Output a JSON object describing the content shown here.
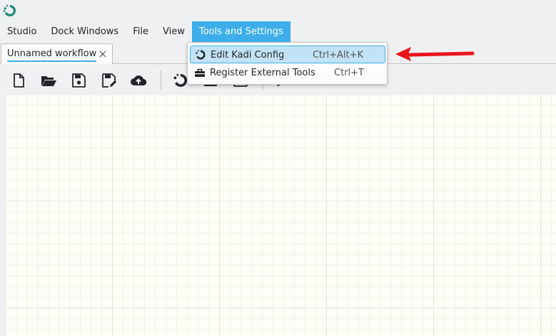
{
  "menubar": {
    "items": [
      {
        "label": "Studio"
      },
      {
        "label": "Dock Windows"
      },
      {
        "label": "File"
      },
      {
        "label": "View"
      },
      {
        "label": "Tools and Settings",
        "active": true
      }
    ]
  },
  "tabs": [
    {
      "label": "Unnamed workflow",
      "close_icon": "close-icon"
    }
  ],
  "toolbar": {
    "buttons": [
      {
        "icon": "new-file-icon"
      },
      {
        "icon": "open-folder-icon"
      },
      {
        "icon": "save-icon"
      },
      {
        "icon": "save-as-icon"
      },
      {
        "icon": "upload-cloud-icon"
      },
      {
        "icon": "kadi-logo-icon"
      },
      {
        "icon": "toolbox-icon"
      },
      {
        "icon": "toolbar-icon"
      },
      {
        "icon": "edit-icon"
      }
    ]
  },
  "dropdown": {
    "items": [
      {
        "label": "Edit Kadi Config",
        "shortcut": "Ctrl+Alt+K",
        "icon": "kadi-logo-icon",
        "highlighted": true
      },
      {
        "label": "Register External Tools",
        "shortcut": "Ctrl+T",
        "icon": "toolbox-icon",
        "highlighted": false
      }
    ]
  },
  "annotation": {
    "type": "arrow",
    "color": "#e8151b"
  },
  "colors": {
    "accent": "#3daee9",
    "menu_active_text": "#fcfcfc",
    "hover_fill": "#c2e3f5",
    "logo": "#1e8a7a",
    "window_bg": "#eff0f1",
    "canvas_bg": "#fdfdf8"
  }
}
